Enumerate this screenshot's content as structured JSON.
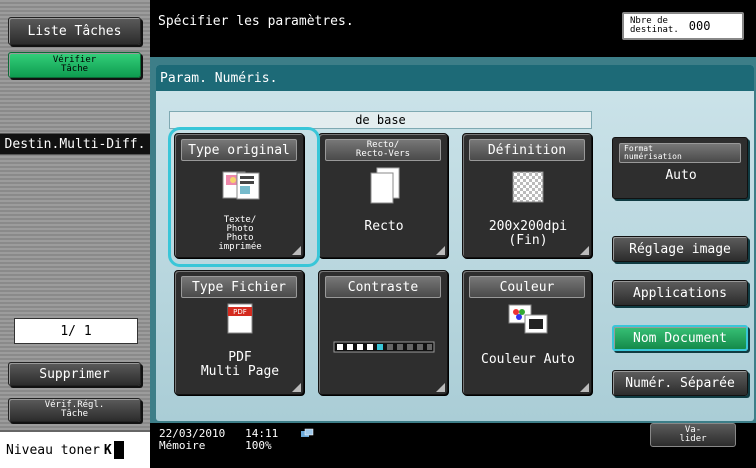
{
  "sidebar": {
    "liste_taches": "Liste Tâches",
    "verifier_tache": "Vérifier\nTâche",
    "destin_multi": "Destin.Multi-Diff.",
    "page_indicator": "1/ 1",
    "supprimer": "Supprimer",
    "verif_regl": "Vérif.Régl.\nTâche",
    "niveau_toner": "Niveau toner",
    "toner_mark": "K"
  },
  "header": {
    "title": "Spécifier les paramètres.",
    "dest_label": "Nbre de\ndestinat.",
    "dest_value": "000"
  },
  "main": {
    "panel_title": "Param. Numéris.",
    "base_tab": "de base",
    "tiles": [
      {
        "title": "Type original",
        "value": "Texte/\nPhoto\nPhoto\nimprimée",
        "icon": "document-photo-icon"
      },
      {
        "title": "Recto/\nRecto-Vers",
        "value": "Recto",
        "icon": "pages-icon"
      },
      {
        "title": "Définition",
        "value": "200x200dpi\n(Fin)",
        "icon": "resolution-grid-icon"
      },
      {
        "title": "Type Fichier",
        "value": "PDF\nMulti Page",
        "icon": "pdf-icon",
        "icon_text": "PDF"
      },
      {
        "title": "Contraste",
        "value": "",
        "icon": "contrast-slider-icon"
      },
      {
        "title": "Couleur",
        "value": "Couleur Auto",
        "icon": "color-auto-icon"
      }
    ],
    "format": {
      "title": "Format\nnumérisation",
      "value": "Auto"
    },
    "right_buttons": {
      "reglage_image": "Réglage image",
      "applications": "Applications",
      "nom_document": "Nom Document",
      "numer_separee": "Numér. Séparée"
    }
  },
  "footer": {
    "datetime": "22/03/2010   14:11",
    "memory": "Mémoire      100%",
    "valider": "Va-\nlider"
  },
  "colors": {
    "accent": "#39c6d8",
    "panel": "#3d7e88",
    "green": "#1aa35a"
  }
}
